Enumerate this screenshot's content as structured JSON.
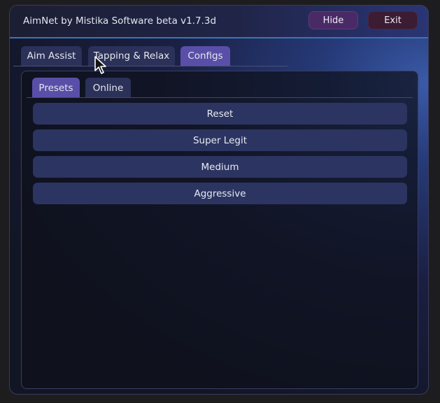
{
  "window": {
    "title": "AimNet by Mistika Software beta v1.7.3d",
    "hide_label": "Hide",
    "exit_label": "Exit"
  },
  "tabs": [
    {
      "label": "Aim Assist",
      "active": false
    },
    {
      "label": "Tapping & Relax",
      "active": false
    },
    {
      "label": "Configs",
      "active": true
    }
  ],
  "subtabs": [
    {
      "label": "Presets",
      "active": true
    },
    {
      "label": "Online",
      "active": false
    }
  ],
  "presets": [
    {
      "label": "Reset"
    },
    {
      "label": "Super Legit"
    },
    {
      "label": "Medium"
    },
    {
      "label": "Aggressive"
    }
  ],
  "colors": {
    "accent_tab": "#5a4fa8",
    "inactive_tab": "#2b3158",
    "button": "#2c3561",
    "titlebar_line": "#3a76b6"
  },
  "cursor_icon": "mouse-pointer-icon"
}
